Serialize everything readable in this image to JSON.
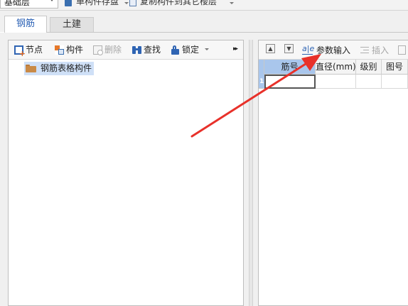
{
  "toolbar": {
    "floor_select_value": "基础层",
    "save_component_label": "单构件存盘",
    "copy_component_label": "复制构件到其它楼层"
  },
  "tabs": [
    {
      "label": "钢筋",
      "active": true
    },
    {
      "label": "土建",
      "active": false
    }
  ],
  "left_toolbar": {
    "node": "节点",
    "component": "构件",
    "delete": "删除",
    "find": "查找",
    "lock": "锁定",
    "more": "▸▸"
  },
  "tree": {
    "root_label": "钢筋表格构件"
  },
  "right_toolbar": {
    "param_input": "参数输入",
    "param_icon": "a|e",
    "insert": "插入"
  },
  "grid": {
    "columns": [
      "筋号",
      "直径(mm)",
      "级别",
      "图号"
    ],
    "row_numbers": [
      "1"
    ]
  },
  "colors": {
    "accent": "#2c62b5",
    "selection": "#a9c6ec",
    "annotation": "#e8312a"
  }
}
